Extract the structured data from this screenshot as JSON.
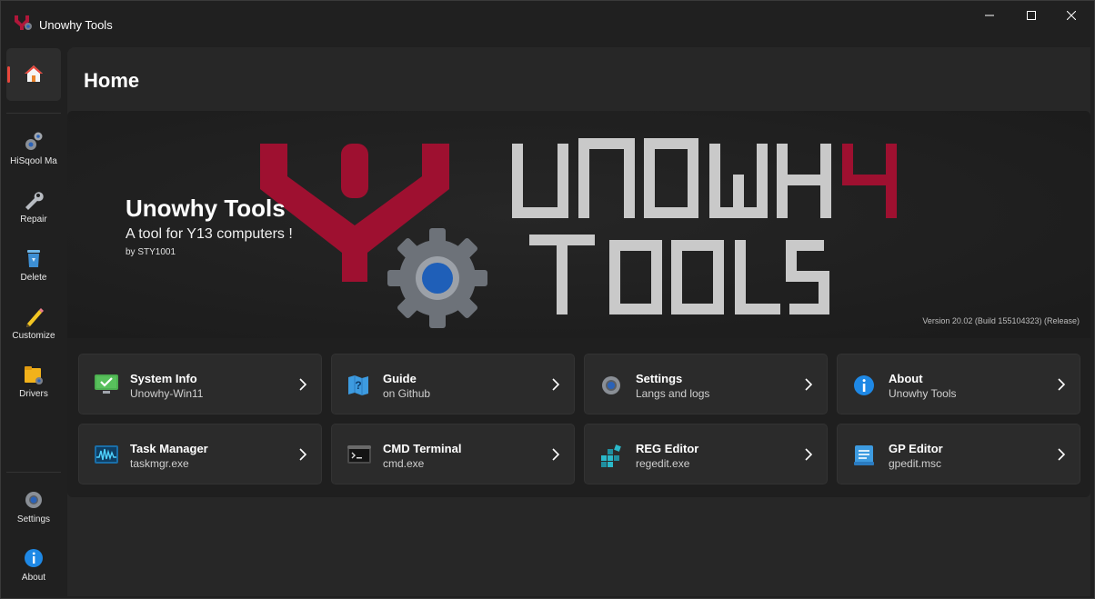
{
  "app": {
    "title": "Unowhy Tools"
  },
  "window_controls": {
    "minimize": "—",
    "maximize": "☐",
    "close": "✕"
  },
  "sidebar": {
    "items": [
      {
        "label": "HiSqool Ma"
      },
      {
        "label": "Repair"
      },
      {
        "label": "Delete"
      },
      {
        "label": "Customize"
      },
      {
        "label": "Drivers"
      }
    ],
    "footer": [
      {
        "label": "Settings"
      },
      {
        "label": "About"
      }
    ]
  },
  "page": {
    "title": "Home"
  },
  "hero": {
    "title": "Unowhy Tools",
    "subtitle": "A tool for Y13 computers !",
    "byline": "by STY1001",
    "version": "Version 20.02 (Build 155104323) (Release)"
  },
  "cards": [
    {
      "title": "System Info",
      "subtitle": "Unowhy-Win11"
    },
    {
      "title": "Guide",
      "subtitle": "on Github"
    },
    {
      "title": "Settings",
      "subtitle": "Langs and logs"
    },
    {
      "title": "About",
      "subtitle": "Unowhy Tools"
    },
    {
      "title": "Task Manager",
      "subtitle": "taskmgr.exe"
    },
    {
      "title": "CMD Terminal",
      "subtitle": "cmd.exe"
    },
    {
      "title": "REG Editor",
      "subtitle": "regedit.exe"
    },
    {
      "title": "GP Editor",
      "subtitle": "gpedit.msc"
    }
  ],
  "colors": {
    "accent": "#e8473c",
    "brand": "#9e1030",
    "background": "#202020"
  }
}
